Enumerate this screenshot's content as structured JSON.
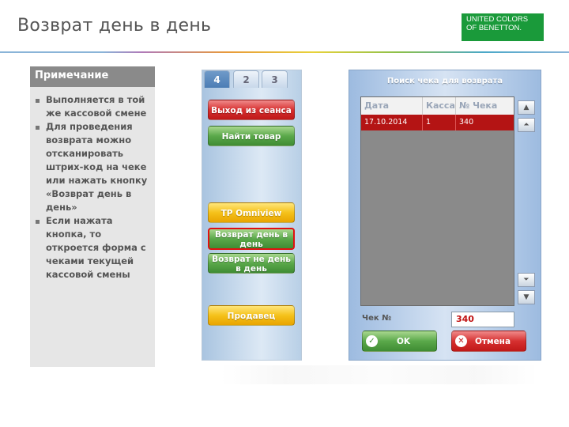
{
  "slide": {
    "title": "Возврат день в день",
    "logo_lines": [
      "UNITED COLORS",
      "OF BENETTON."
    ],
    "logo_color": "#1a9a3a"
  },
  "note": {
    "heading": "Примечание",
    "items": [
      "Выполняется в той же кассовой смене",
      "Для проведения возврата можно отсканировать штрих-код на чеке или нажать кнопку «Возврат день в день»",
      "Если нажата кнопка, то откроется форма с чеками текущей кассовой смены"
    ]
  },
  "pos_panel": {
    "tabs": [
      "4",
      "2",
      "3"
    ],
    "buttons": {
      "logout": "Выход из сеанса",
      "find_item": "Найти товар",
      "tp_omniview": "TP Omniview",
      "return_same_day": "Возврат день в день",
      "return_not_same_day": "Возврат не день в день",
      "seller": "Продавец"
    }
  },
  "dialog": {
    "title": "Поиск чека для возврата",
    "columns": [
      "Дата",
      "Касса",
      "№ Чека"
    ],
    "rows": [
      {
        "date": "17.10.2014",
        "register": "1",
        "receipt": "340"
      }
    ],
    "receipt_label": "Чек №",
    "receipt_value": "340",
    "ok_label": "OK",
    "cancel_label": "Отмена"
  },
  "colors": {
    "accent_red": "#c01818",
    "accent_green": "#3f8c33",
    "accent_yellow": "#f5c11a"
  }
}
